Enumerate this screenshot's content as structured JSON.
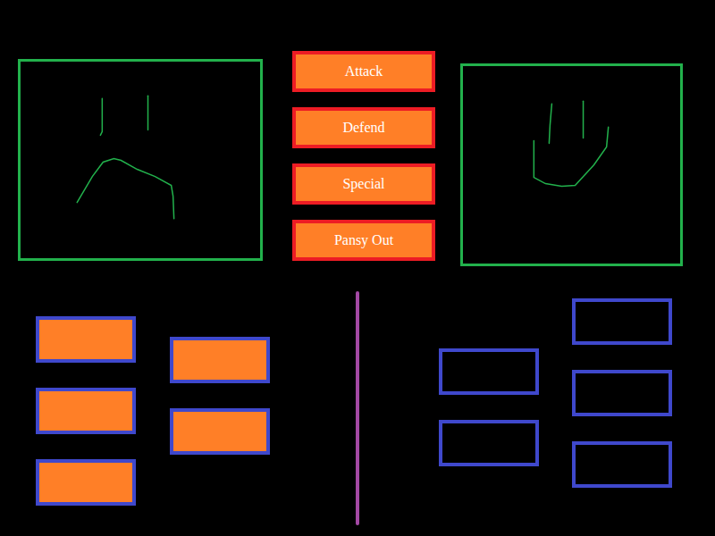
{
  "actions": [
    {
      "label": "Attack"
    },
    {
      "label": "Defend"
    },
    {
      "label": "Special"
    },
    {
      "label": "Pansy Out"
    }
  ],
  "player_party": {
    "columns": [
      [
        {
          "filled": true
        },
        {
          "filled": true
        },
        {
          "filled": true
        }
      ],
      [
        {
          "filled": true
        },
        {
          "filled": true
        }
      ]
    ]
  },
  "enemy_party": {
    "columns": [
      [
        {
          "filled": false
        },
        {
          "filled": false
        }
      ],
      [
        {
          "filled": false
        },
        {
          "filled": false
        },
        {
          "filled": false
        }
      ]
    ]
  }
}
